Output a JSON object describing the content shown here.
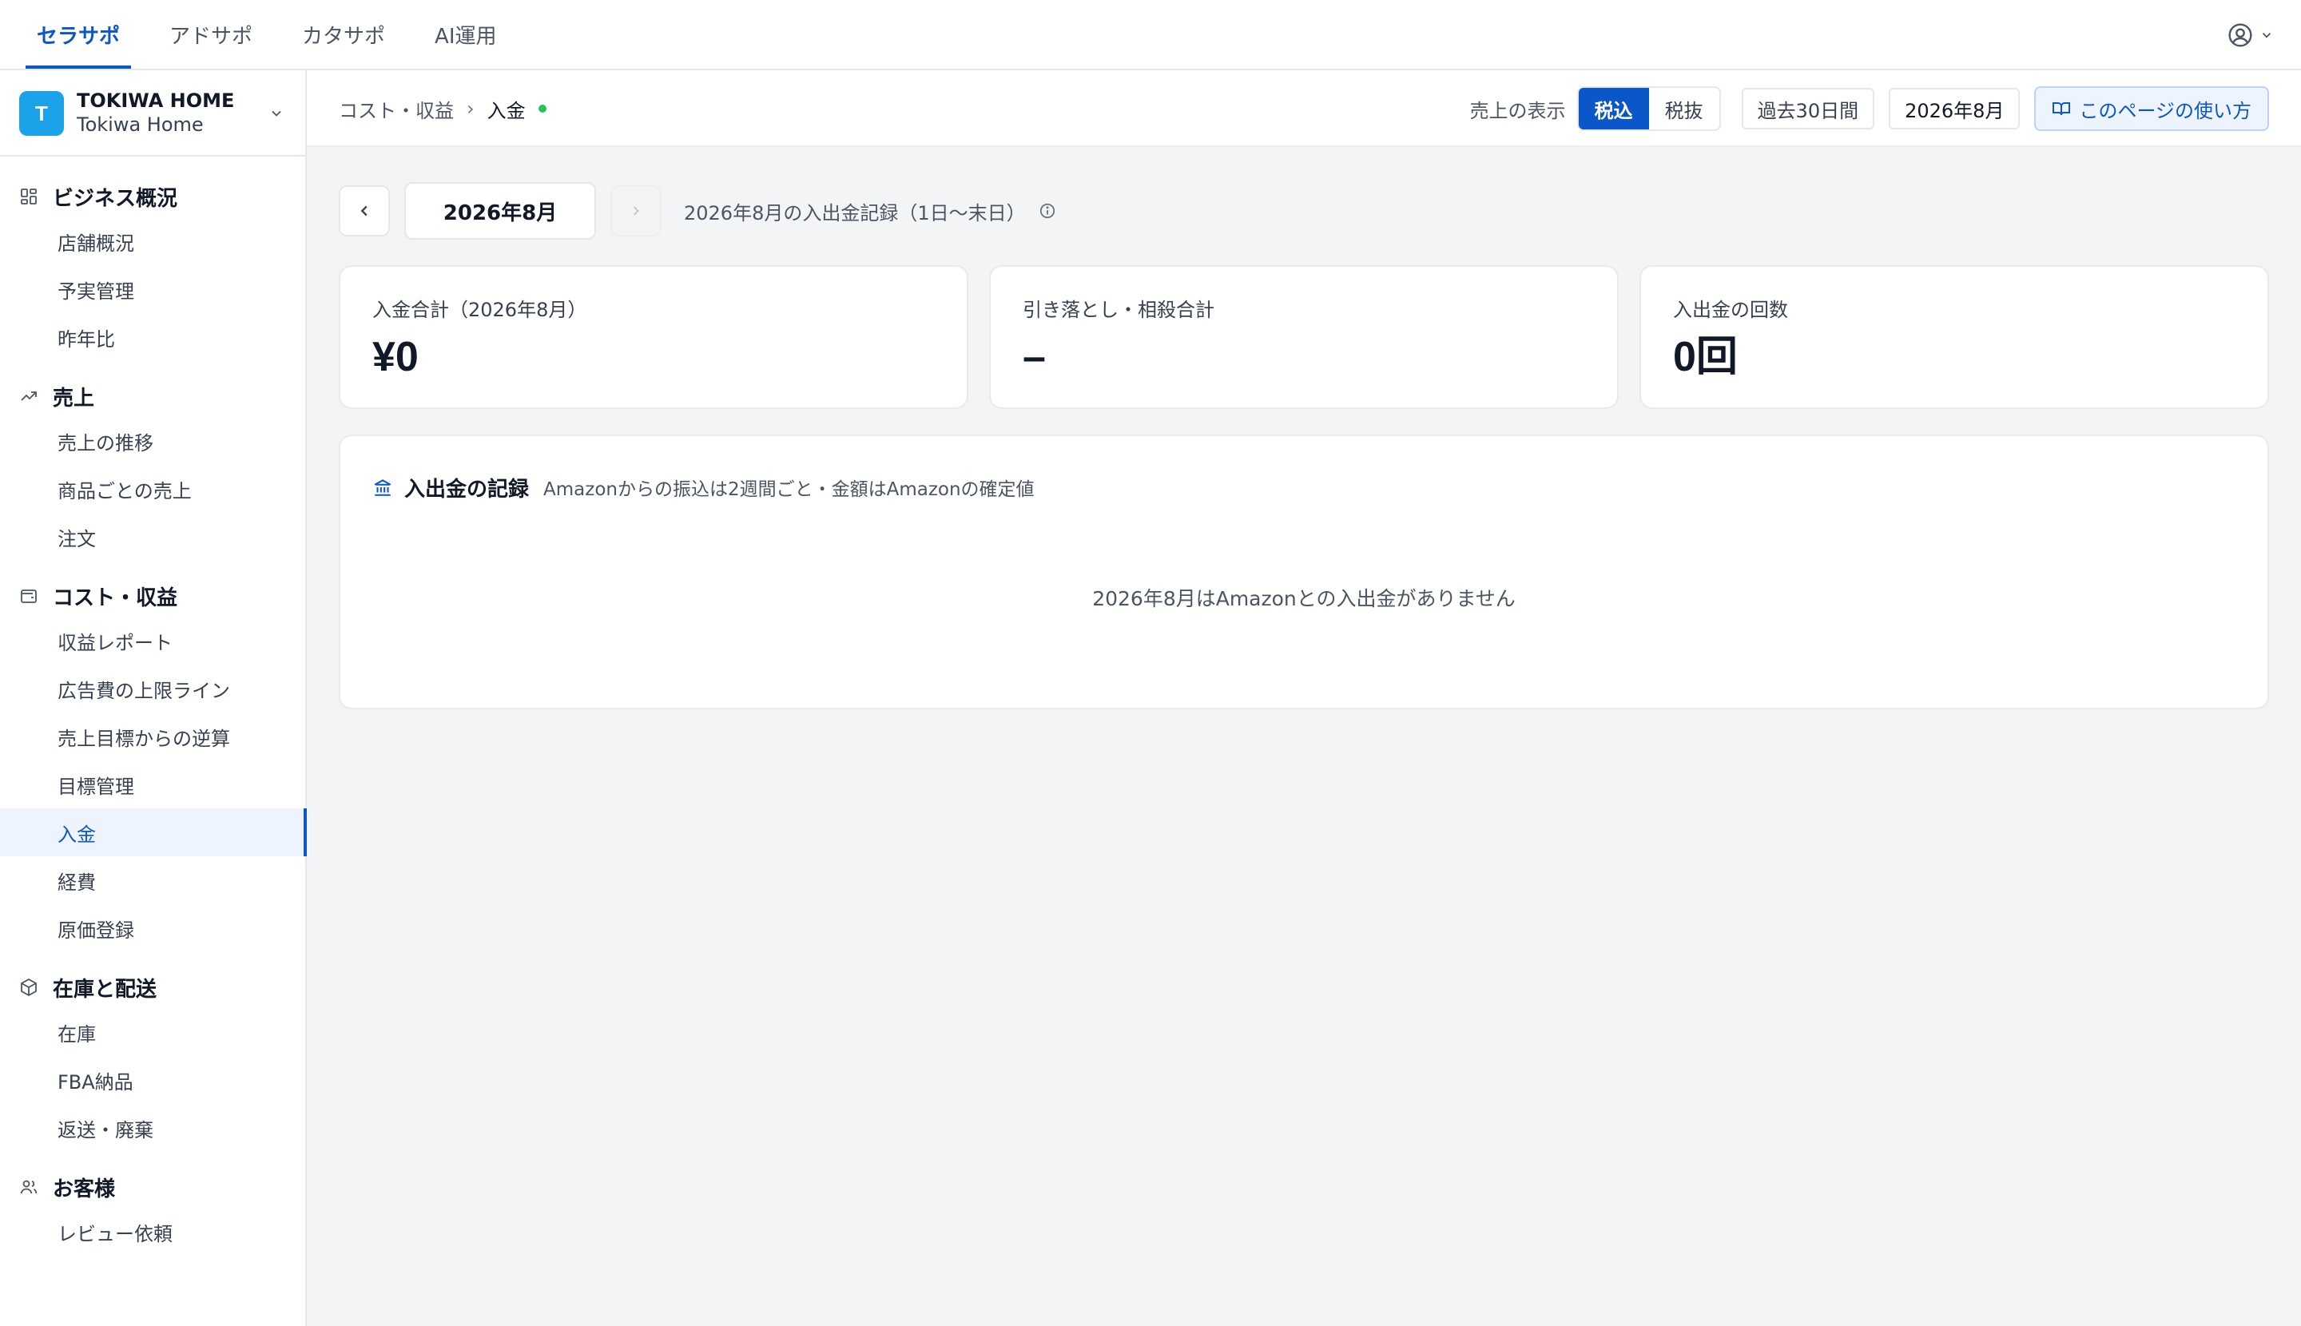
{
  "top_nav": {
    "tabs": [
      {
        "label": "セラサポ"
      },
      {
        "label": "アドサポ"
      },
      {
        "label": "カタサポ"
      },
      {
        "label": "AI運用"
      }
    ],
    "account_icon": "user-circle-icon"
  },
  "store": {
    "initial": "T",
    "name": "TOKIWA HOME",
    "sub": "Tokiwa Home",
    "avatar_color": "#1aa3e8"
  },
  "sidebar": {
    "groups": [
      {
        "label": "ビジネス概況",
        "icon": "grid-icon",
        "items": [
          {
            "label": "店舗概況"
          },
          {
            "label": "予実管理"
          },
          {
            "label": "昨年比"
          }
        ]
      },
      {
        "label": "売上",
        "icon": "trending-up-icon",
        "items": [
          {
            "label": "売上の推移"
          },
          {
            "label": "商品ごとの売上"
          },
          {
            "label": "注文"
          }
        ]
      },
      {
        "label": "コスト・収益",
        "icon": "wallet-icon",
        "items": [
          {
            "label": "収益レポート"
          },
          {
            "label": "広告費の上限ライン"
          },
          {
            "label": "売上目標からの逆算"
          },
          {
            "label": "目標管理"
          },
          {
            "label": "入金"
          },
          {
            "label": "経費"
          },
          {
            "label": "原価登録"
          }
        ]
      },
      {
        "label": "在庫と配送",
        "icon": "box-icon",
        "items": [
          {
            "label": "在庫"
          },
          {
            "label": "FBA納品"
          },
          {
            "label": "返送・廃棄"
          }
        ]
      },
      {
        "label": "お客様",
        "icon": "users-icon",
        "items": [
          {
            "label": "レビュー依頼"
          }
        ]
      }
    ]
  },
  "header": {
    "breadcrumb": {
      "parent": "コスト・収益",
      "separator": "›",
      "current": "入金"
    },
    "tax_label": "売上の表示",
    "tax_options": [
      {
        "label": "税込"
      },
      {
        "label": "税抜"
      }
    ],
    "tax_selected": "税込",
    "range_button": "過去30日間",
    "month_button": "2026年8月",
    "help_button": "このページの使い方"
  },
  "month_nav": {
    "current": "2026年8月",
    "caption": "2026年8月の入出金記録（1日〜末日）"
  },
  "stats": [
    {
      "label": "入金合計（2026年8月）",
      "value": "¥0"
    },
    {
      "label": "引き落とし・相殺合計",
      "value": "–"
    },
    {
      "label": "入出金の回数",
      "value": "0回"
    }
  ],
  "records": {
    "title": "入出金の記録",
    "note": "Amazonからの振込は2週間ごと・金額はAmazonの確定値",
    "empty": "2026年8月はAmazonとの入出金がありません"
  },
  "colors": {
    "accent": "#0b57c9",
    "status_dot": "#22c55e",
    "background": "#f3f4f6"
  }
}
